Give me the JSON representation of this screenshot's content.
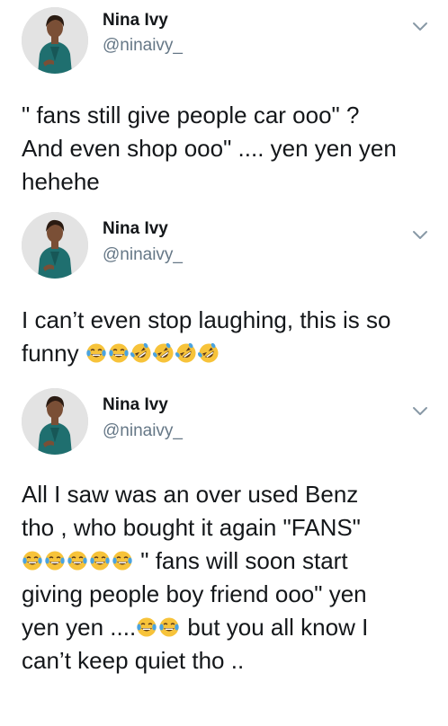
{
  "tweets": [
    {
      "name": "Nina Ivy",
      "handle": "@ninaivy_",
      "lines": [
        "\" fans still give people car ooo\" ?",
        "And even shop ooo\" .... yen yen yen",
        "hehehe"
      ]
    },
    {
      "name": "Nina Ivy",
      "handle": "@ninaivy_",
      "lines": [
        "I can’t even stop laughing, this is so",
        "funny"
      ],
      "emojis": [
        "tears-of-joy",
        "tears-of-joy",
        "rofl",
        "rofl",
        "rofl",
        "rofl"
      ]
    },
    {
      "name": "Nina Ivy",
      "handle": "@ninaivy_",
      "lines": [
        "All I saw was an over used Benz",
        "tho , who bought it again \"FANS\"",
        "\" fans will soon start",
        "giving people boy friend ooo\" yen",
        "yen yen ....",
        "but you all know I",
        "can’t keep quiet tho .."
      ],
      "emojis_line3": [
        "tears-of-joy",
        "tears-of-joy",
        "tears-of-joy",
        "tears-of-joy",
        "tears-of-joy"
      ],
      "emojis_line5": [
        "tears-of-joy",
        "tears-of-joy"
      ]
    }
  ],
  "colors": {
    "text": "#14171a",
    "secondary": "#657786",
    "chevron": "#8899a6",
    "emoji_face": "#f7c33a"
  }
}
